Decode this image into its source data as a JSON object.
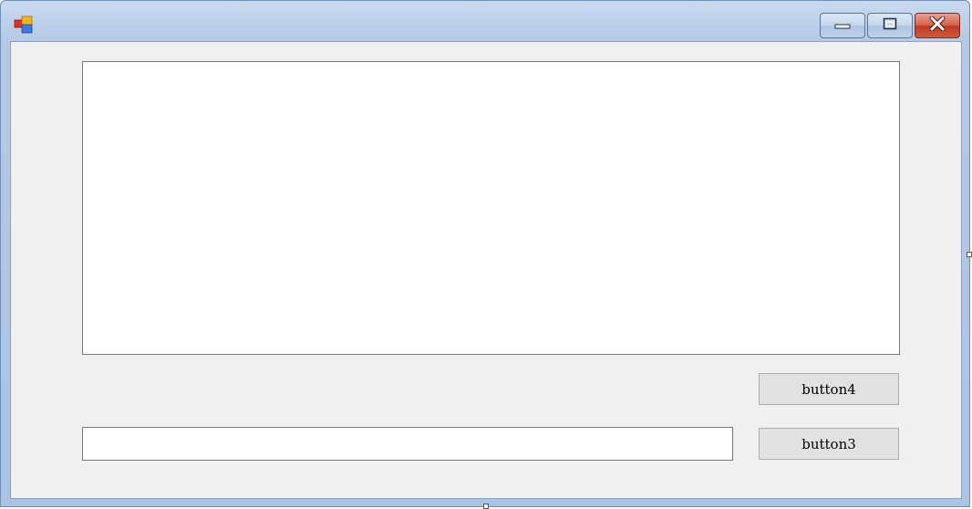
{
  "window": {
    "title": "",
    "icons": {
      "app": "app-icon",
      "minimize": "minimize-icon",
      "maximize": "maximize-icon",
      "close": "close-icon"
    },
    "colors": {
      "frame": "#aac3e3",
      "client_bg": "#f0f0f0",
      "close_button": "#c1381c"
    }
  },
  "form": {
    "multiline_text": "",
    "input_text": "",
    "button4_label": "button4",
    "button3_label": "button3"
  }
}
